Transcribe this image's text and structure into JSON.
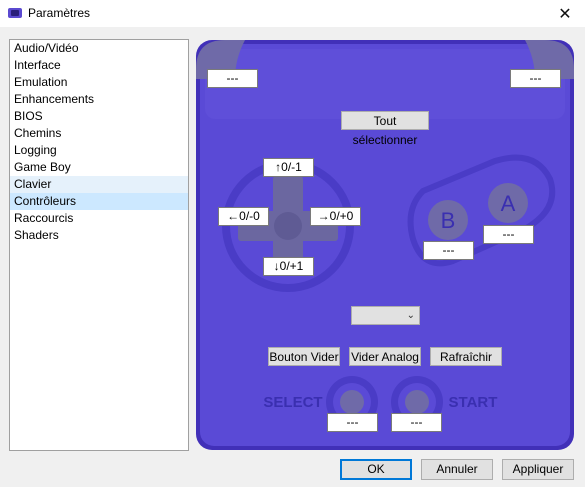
{
  "window": {
    "title": "Paramètres",
    "close_glyph": "✕",
    "app_icon": "app-logo-icon"
  },
  "sidebar": {
    "items": [
      {
        "label": "Audio/Vidéo"
      },
      {
        "label": "Interface"
      },
      {
        "label": "Emulation"
      },
      {
        "label": "Enhancements"
      },
      {
        "label": "BIOS"
      },
      {
        "label": "Chemins"
      },
      {
        "label": "Logging"
      },
      {
        "label": "Game Boy"
      },
      {
        "label": "Clavier"
      },
      {
        "label": "Contrôleurs"
      },
      {
        "label": "Raccourcis"
      },
      {
        "label": "Shaders"
      }
    ],
    "hover_index": 8,
    "selected_index": 9
  },
  "controller": {
    "shoulder_l": "---",
    "shoulder_r": "---",
    "select_all_label": "Tout sélectionner",
    "dpad_up": "↑0/-1",
    "dpad_left": "←0/-0",
    "dpad_right": "→0/+0",
    "dpad_down": "↓0/+1",
    "button_a_glyph": "A",
    "button_b_glyph": "B",
    "button_a_value": "---",
    "button_b_value": "---",
    "profile_select": "",
    "clear_button_label": "Bouton Vider",
    "clear_analog_label": "Vider Analog",
    "refresh_label": "Rafraîchir",
    "select_caption": "SELECT",
    "start_caption": "START",
    "select_value": "---",
    "start_value": "---"
  },
  "footer": {
    "ok_label": "OK",
    "cancel_label": "Annuler",
    "apply_label": "Appliquer"
  },
  "colors": {
    "pad_body": "#5a4ad6",
    "pad_border": "#3f30b5",
    "pad_light": "#6e5fe4",
    "shoulder": "#6f6aa8",
    "dpad_ring": "#4a3cc6",
    "dpad_cross": "#6b67a0",
    "face_button": "#6f6aa8",
    "caption": "#3a2fb0",
    "accent": "#0078d7"
  }
}
